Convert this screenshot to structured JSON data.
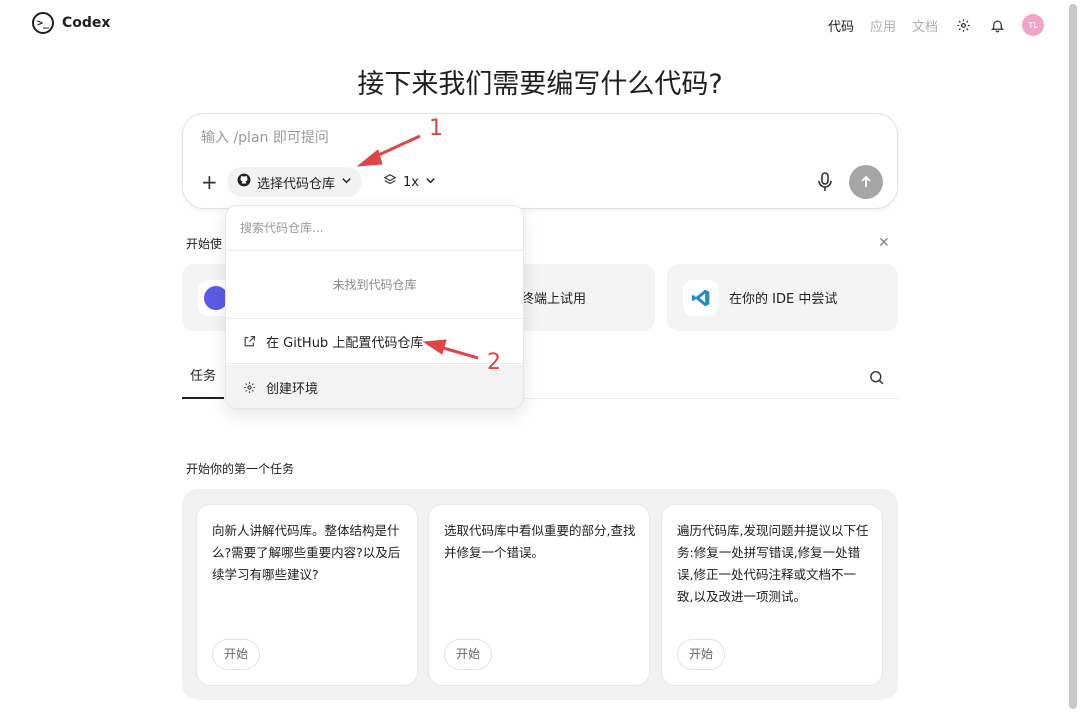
{
  "app": {
    "name": "Codex",
    "logo_glyph": ">_"
  },
  "nav": {
    "items": [
      {
        "label": "代码",
        "active": true
      },
      {
        "label": "应用",
        "active": false
      },
      {
        "label": "文档",
        "active": false
      }
    ],
    "avatar_initials": "TL"
  },
  "main": {
    "title": "接下来我们需要编写什么代码?"
  },
  "composer": {
    "placeholder": "输入 /plan 即可提问",
    "repo_button_label": "选择代码仓库",
    "multiplier_label": "1x"
  },
  "dropdown": {
    "search_placeholder": "搜索代码仓库...",
    "empty_text": "未找到代码仓库",
    "items": [
      {
        "label": "在 GitHub 上配置代码仓库",
        "icon": "external-link-icon"
      },
      {
        "label": "创建环境",
        "icon": "gear-icon"
      }
    ]
  },
  "annotations": {
    "one": "1",
    "two": "2"
  },
  "get_started": {
    "label": "开始使",
    "cards": [
      {
        "label": "",
        "icon": "cli-icon"
      },
      {
        "label": "终端上试用",
        "icon": "terminal-icon"
      },
      {
        "label": "在你的 IDE 中尝试",
        "icon": "vscode-icon"
      }
    ]
  },
  "tabs": {
    "items": [
      {
        "label": "任务"
      }
    ]
  },
  "first_task": {
    "label": "开始你的第一个任务",
    "cards": [
      {
        "text": "向新人讲解代码库。整体结构是什么?需要了解哪些重要内容?以及后续学习有哪些建议?",
        "button": "开始"
      },
      {
        "text": "选取代码库中看似重要的部分,查找并修复一个错误。",
        "button": "开始"
      },
      {
        "text": "遍历代码库,发现问题并提议以下任务:修复一处拼写错误,修复一处错误,修正一处代码注释或文档不一致,以及改进一项测试。",
        "button": "开始"
      }
    ]
  },
  "colors": {
    "accent_annotation": "#e04545",
    "avatar_bg": "#f2a3c9",
    "send_btn": "#a6a6a6"
  }
}
